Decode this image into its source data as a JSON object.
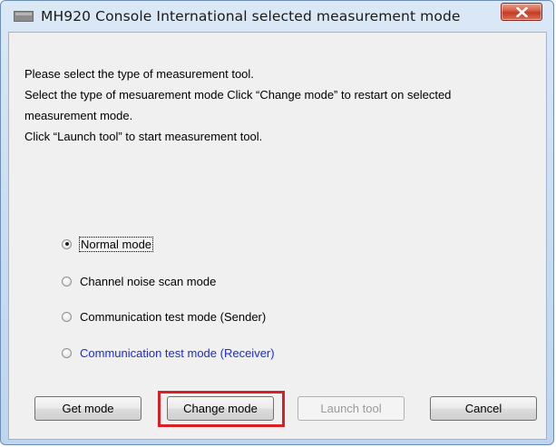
{
  "window": {
    "title": "MH920 Console International selected measurement mode"
  },
  "instructions": {
    "line1": "Please select the type of measurement tool.",
    "line2": "Select the type of mesuarement mode Click “Change mode” to restart on selected",
    "line3": "measurement mode.",
    "line4": "Click “Launch tool” to start  measurement tool."
  },
  "modes": [
    {
      "label": "Normal mode",
      "selected": true
    },
    {
      "label": "Channel noise scan mode",
      "selected": false
    },
    {
      "label": "Communication test mode (Sender)",
      "selected": false
    },
    {
      "label": "Communication test mode (Receiver)",
      "selected": false
    }
  ],
  "buttons": {
    "get_mode": "Get mode",
    "change_mode": "Change mode",
    "launch_tool": "Launch tool",
    "cancel": "Cancel"
  },
  "colors": {
    "highlight": "#d81f26",
    "receiver_label": "#1a2bd6"
  },
  "icons": {
    "app": "console-window-icon",
    "close": "close-icon"
  }
}
